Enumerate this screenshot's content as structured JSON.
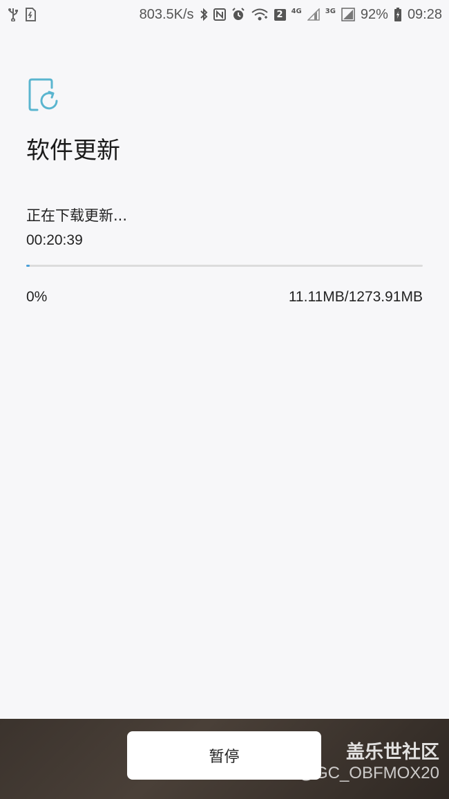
{
  "status_bar": {
    "net_speed": "803.5K/s",
    "sim_badge": "2",
    "network_4g": "4G",
    "network_3g": "3G",
    "battery": "92%",
    "time": "09:28",
    "icons": [
      "usb-icon",
      "sd-card-icon",
      "bluetooth-icon",
      "nfc-icon",
      "alarm-icon",
      "wifi-icon",
      "signal-icon",
      "battery-charging-icon"
    ]
  },
  "page": {
    "title": "软件更新",
    "status": "正在下载更新...",
    "elapsed": "00:20:39",
    "progress_fraction": 0.0087,
    "percent": "0%",
    "size": "11.11MB/1273.91MB",
    "accent_color": "#4aa0d9"
  },
  "bottom": {
    "pause_label": "暂停",
    "watermark_title": "盖乐世社区",
    "watermark_user": "@GC_OBFMOX20"
  }
}
